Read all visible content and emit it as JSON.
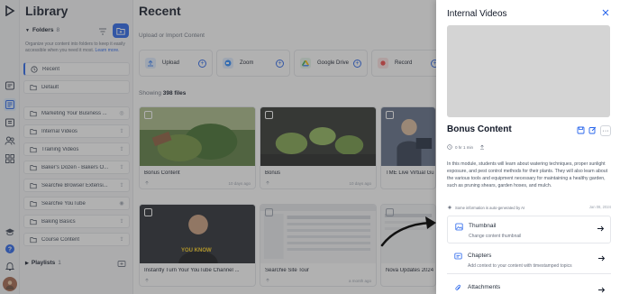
{
  "sidebar_rail": {
    "icons": [
      "logo-icon",
      "home-icon",
      "library-icon",
      "share-icon",
      "users-icon",
      "apps-icon",
      "graduation-icon",
      "help-icon",
      "bell-icon",
      "avatar"
    ]
  },
  "library": {
    "title": "Library",
    "folders_label": "Folders",
    "folders_count": "8",
    "description": "Organize your content into folders to keep it easily accessible when you need it most.",
    "learn_more": "Learn more.",
    "items": [
      {
        "label": "Recent",
        "icon": "clock-icon",
        "trail": ""
      },
      {
        "label": "Default",
        "icon": "folder-icon",
        "trail": ""
      },
      {
        "label": "Marketing Your Business ...",
        "icon": "folder-icon",
        "trail": "globe-icon"
      },
      {
        "label": "Internal Videos",
        "icon": "folder-icon",
        "trail": "share-icon"
      },
      {
        "label": "Training Videos",
        "icon": "folder-icon",
        "trail": "share-icon"
      },
      {
        "label": "Baker's Dozen - Bakers O...",
        "icon": "folder-icon",
        "trail": "share-icon"
      },
      {
        "label": "Searchie Browser Extensi...",
        "icon": "folder-icon",
        "trail": "share-icon"
      },
      {
        "label": "Searchie YouTube",
        "icon": "folder-icon",
        "trail": "eye-icon"
      },
      {
        "label": "Baking Basics",
        "icon": "folder-icon",
        "trail": "share-icon"
      },
      {
        "label": "Course Content",
        "icon": "folder-icon",
        "trail": "share-icon"
      }
    ],
    "playlists_label": "Playlists",
    "playlists_count": "1"
  },
  "recent": {
    "title": "Recent",
    "upload_label": "Upload or Import Content",
    "sources": [
      {
        "label": "Upload",
        "icon": "upload-icon",
        "color": "#3b82f6"
      },
      {
        "label": "Zoom",
        "icon": "zoom-icon",
        "color": "#2d8cff"
      },
      {
        "label": "Google Drive",
        "icon": "drive-icon",
        "color": "#34a853"
      },
      {
        "label": "Record",
        "icon": "record-icon",
        "color": "#ef4444"
      }
    ],
    "showing_prefix": "Showing",
    "showing_count": "398 files",
    "videos": [
      {
        "title": "Bonus Content",
        "age": "10 days ago"
      },
      {
        "title": "Bonus",
        "age": "10 days ago"
      },
      {
        "title": "TME Live Virtual Gu",
        "age": ""
      },
      {
        "title": "Instantly Turn Your YouTube Channel ...",
        "age": ""
      },
      {
        "title": "Searchie Site Tour",
        "age": "a month ago"
      },
      {
        "title": "Nova Updates 2024",
        "age": ""
      }
    ],
    "thumb_caption": "YOU KNOW"
  },
  "panel": {
    "title": "Internal Videos",
    "video_title": "Bonus Content",
    "meta": "0 hr 1 min",
    "description": "In this module, students will learn about watering techniques, proper sunlight exposure, and pest control methods for their plants. They will also learn about the various tools and equipment necessary for maintaining a healthy garden, such as pruning shears, garden hoses, and mulch.",
    "ai_note": "Some information is auto-generated by AI",
    "date": "Jan 08, 2024",
    "options": [
      {
        "title": "Thumbnail",
        "desc": "Change content thumbnail",
        "icon": "image-icon"
      },
      {
        "title": "Chapters",
        "desc": "Add context to your content with timestamped topics",
        "icon": "chapters-icon"
      },
      {
        "title": "Attachments",
        "desc": "",
        "icon": "paperclip-icon"
      }
    ]
  }
}
